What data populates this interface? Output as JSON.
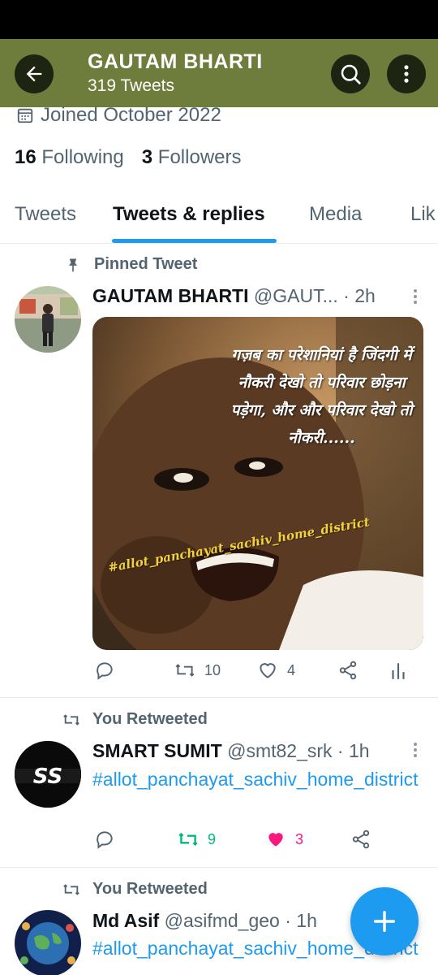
{
  "header": {
    "name": "GAUTAM BHARTI",
    "tweet_count": "319 Tweets"
  },
  "profile": {
    "joined": "Joined October 2022",
    "following_count": "16",
    "following_label": "Following",
    "followers_count": "3",
    "followers_label": "Followers"
  },
  "tabs": [
    {
      "label": "Tweets"
    },
    {
      "label": "Tweets & replies"
    },
    {
      "label": "Media"
    },
    {
      "label": "Lik"
    }
  ],
  "tweets": [
    {
      "context": "Pinned Tweet",
      "name": "GAUTAM BHARTI",
      "meta": "@GAUT... · 2h",
      "media_text": "गज़ब का परेशानियां है जिंदगी में नौकरी देखो तो परिवार छोड़ना पड़ेगा, और और परिवार देखो तो नौकरी......",
      "media_tag": "#allot_panchayat_sachiv_home_district",
      "retweets": "10",
      "likes": "4"
    },
    {
      "context": "You Retweeted",
      "name": "SMART SUMIT",
      "meta": "@smt82_srk · 1h",
      "text": "#allot_panchayat_sachiv_home_district",
      "retweets": "9",
      "likes": "3",
      "avatar_text": "SS"
    },
    {
      "context": "You Retweeted",
      "name": "Md Asif",
      "meta": "@asifmd_geo · 1h",
      "text": "#allot_panchayat_sachiv_home_district"
    }
  ],
  "colors": {
    "header_bg": "#6e7d3c",
    "accent": "#1d9bf0",
    "retweet_active": "#00ba7c",
    "like_active": "#f91880"
  }
}
